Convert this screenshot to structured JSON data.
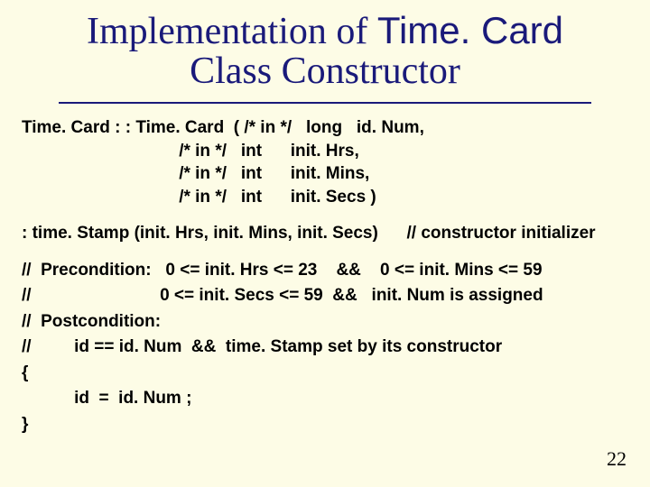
{
  "title": {
    "line1_pre": "Implementation of ",
    "line1_accent": "Time. Card",
    "line2": "Class Constructor"
  },
  "signature": {
    "l1": "Time. Card : : Time. Card  ( /* in */   long   id. Num,",
    "l2": "                                 /* in */   int      init. Hrs,",
    "l3": "                                 /* in */   int      init. Mins,",
    "l4": "                                 /* in */   int      init. Secs )"
  },
  "initializer": {
    "text": "   :  time. Stamp (init. Hrs, init. Mins, init. Secs)",
    "comment": "// constructor initializer"
  },
  "body": {
    "l1": "//  Precondition:   0 <= init. Hrs <= 23    &&    0 <= init. Mins <= 59",
    "l2": "//                           0 <= init. Secs <= 59  &&   init. Num is assigned",
    "l3": "//  Postcondition:",
    "l4": "//         id == id. Num  &&  time. Stamp set by its constructor",
    "l5": "{",
    "l6": "           id  =  id. Num ;",
    "l7": "}"
  },
  "page_number": "22"
}
